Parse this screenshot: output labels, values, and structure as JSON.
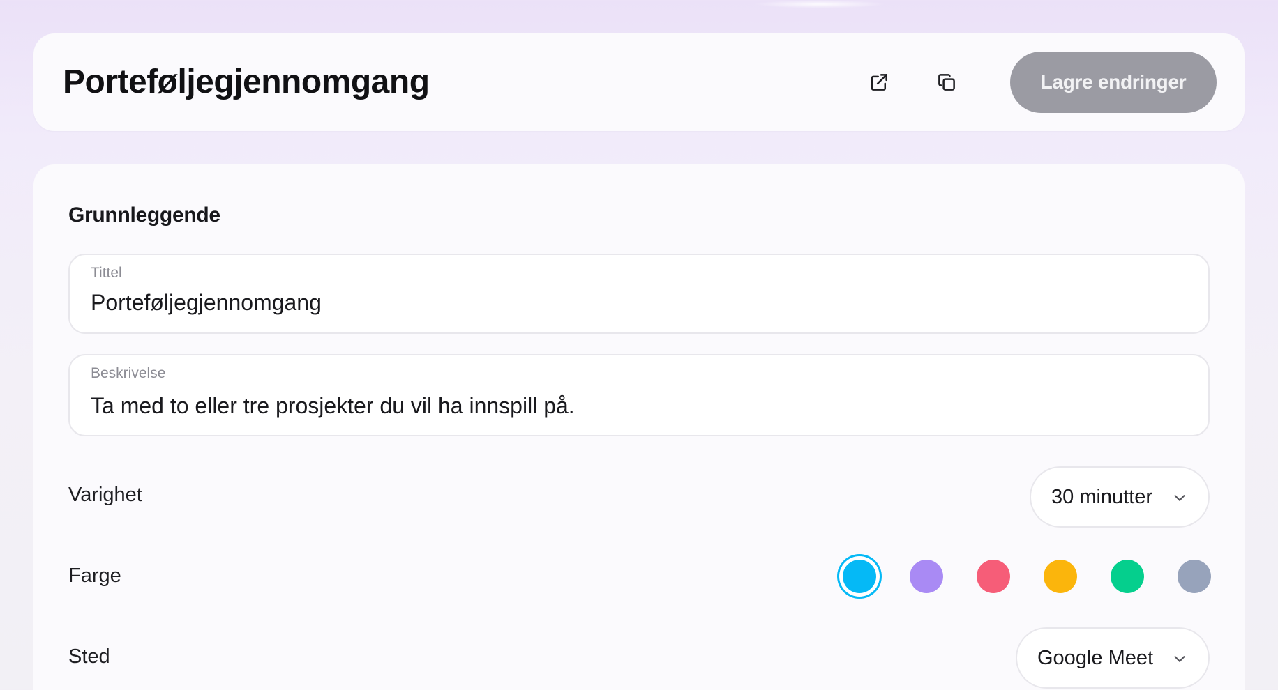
{
  "header": {
    "title": "Porteføljegjennomgang",
    "save_label": "Lagre endringer",
    "icons": [
      "external-link-icon",
      "copy-icon"
    ]
  },
  "section": {
    "heading": "Grunnleggende"
  },
  "fields": {
    "title": {
      "label": "Tittel",
      "value": "Porteføljegjennomgang"
    },
    "description": {
      "label": "Beskrivelse",
      "value": "Ta med to eller tre prosjekter du vil ha innspill på."
    }
  },
  "duration": {
    "label": "Varighet",
    "value": "30 minutter"
  },
  "color": {
    "label": "Farge",
    "options": [
      "#05b9f6",
      "#a98af4",
      "#f65d78",
      "#fbb50c",
      "#05cf8d",
      "#97a3bb"
    ],
    "selected": "#05b9f6"
  },
  "location": {
    "label": "Sted",
    "value": "Google Meet"
  },
  "theme": {
    "save_button_bg": "#9b9ba3",
    "accent": "#05b9f6"
  }
}
